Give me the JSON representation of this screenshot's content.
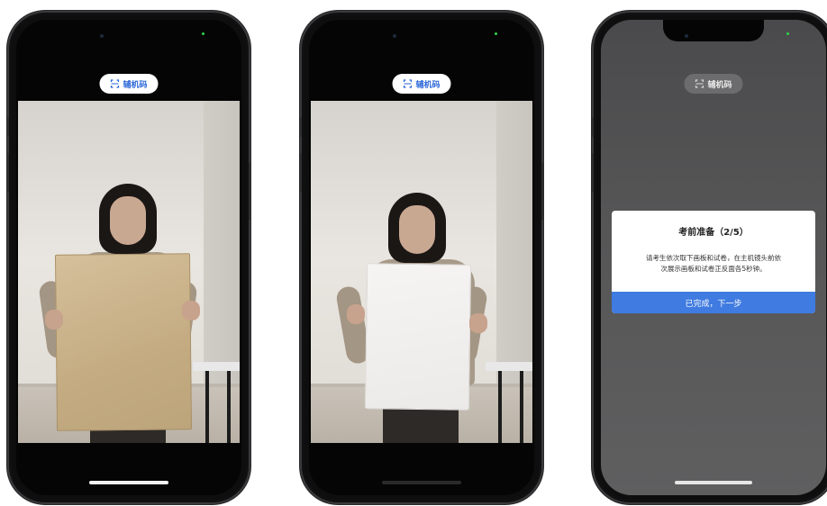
{
  "phones": [
    {
      "pill_label": "辅机码",
      "board_color": "#c9b28b"
    },
    {
      "pill_label": "辅机码",
      "board_color": "#f1efee"
    },
    {
      "pill_label": "辅机码"
    }
  ],
  "dialog": {
    "title": "考前准备（2/5）",
    "line1": "请考生依次取下画板和试卷，在主机镜头前依",
    "line2": "次展示画板和试卷正反面各5秒钟。",
    "button": "已完成，下一步"
  }
}
